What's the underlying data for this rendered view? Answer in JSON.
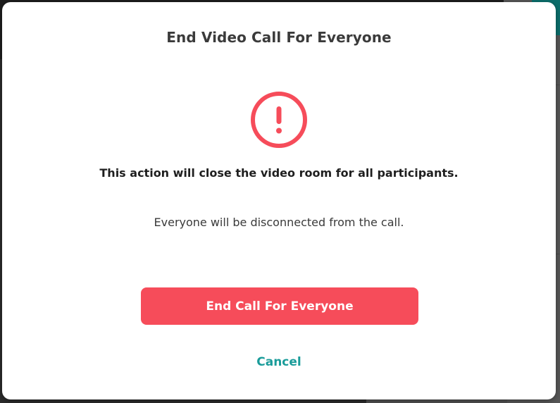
{
  "dialog": {
    "title": "End Video Call For Everyone",
    "icon": "exclamation-circle-icon",
    "message_main": "This action will close the video room for all participants.",
    "message_sub": "Everyone will be disconnected from the call.",
    "confirm_label": "End Call For Everyone",
    "cancel_label": "Cancel"
  },
  "colors": {
    "danger": "#f64c5a",
    "link": "#1a9c9a",
    "title": "#3b3b3b"
  }
}
